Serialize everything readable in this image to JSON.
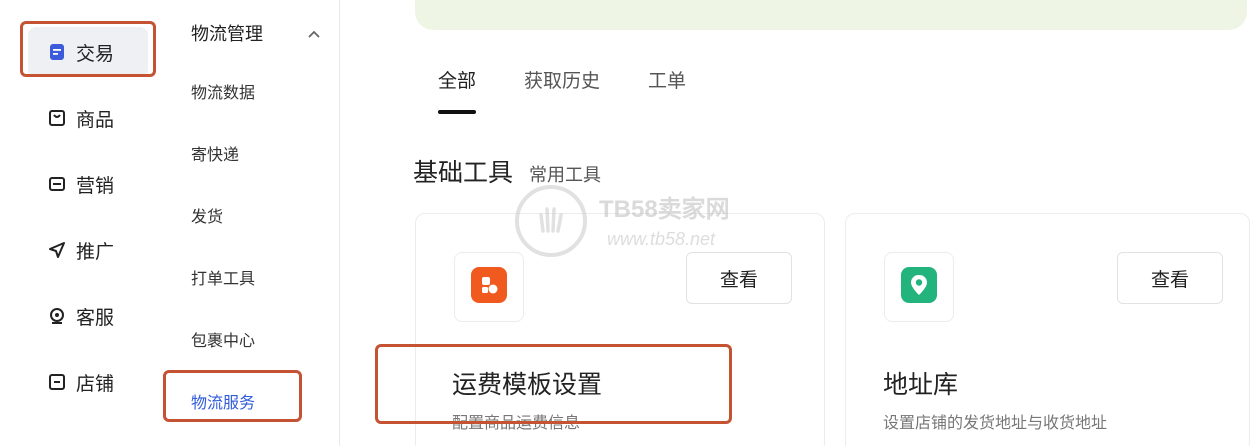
{
  "primary_nav": {
    "items": [
      {
        "label": "交易",
        "icon": "document-icon",
        "active": true
      },
      {
        "label": "商品",
        "icon": "bag-icon"
      },
      {
        "label": "营销",
        "icon": "coupon-icon"
      },
      {
        "label": "推广",
        "icon": "send-icon"
      },
      {
        "label": "客服",
        "icon": "headset-icon"
      },
      {
        "label": "店铺",
        "icon": "store-icon"
      }
    ]
  },
  "sub_nav": {
    "header": "物流管理",
    "items": [
      "物流数据",
      "寄快递",
      "发货",
      "打单工具",
      "包裹中心",
      "物流服务"
    ],
    "active_index": 5
  },
  "tabs": [
    "全部",
    "获取历史",
    "工单"
  ],
  "section": {
    "title": "基础工具",
    "subtitle": "常用工具"
  },
  "cards": [
    {
      "title": "运费模板设置",
      "desc": "配置商品运费信息",
      "view_label": "查看",
      "icon_color": "#f05a1e",
      "icon": "template-icon"
    },
    {
      "title": "地址库",
      "desc": "设置店铺的发货地址与收货地址",
      "view_label": "查看",
      "icon_color": "#23b47e",
      "icon": "location-pin-icon"
    }
  ],
  "watermark": {
    "name": "TB58卖家网",
    "url": "www.tb58.net"
  },
  "colors": {
    "highlight": "#c45233",
    "active_link": "#2f5bd8",
    "banner": "#eef5e4"
  }
}
